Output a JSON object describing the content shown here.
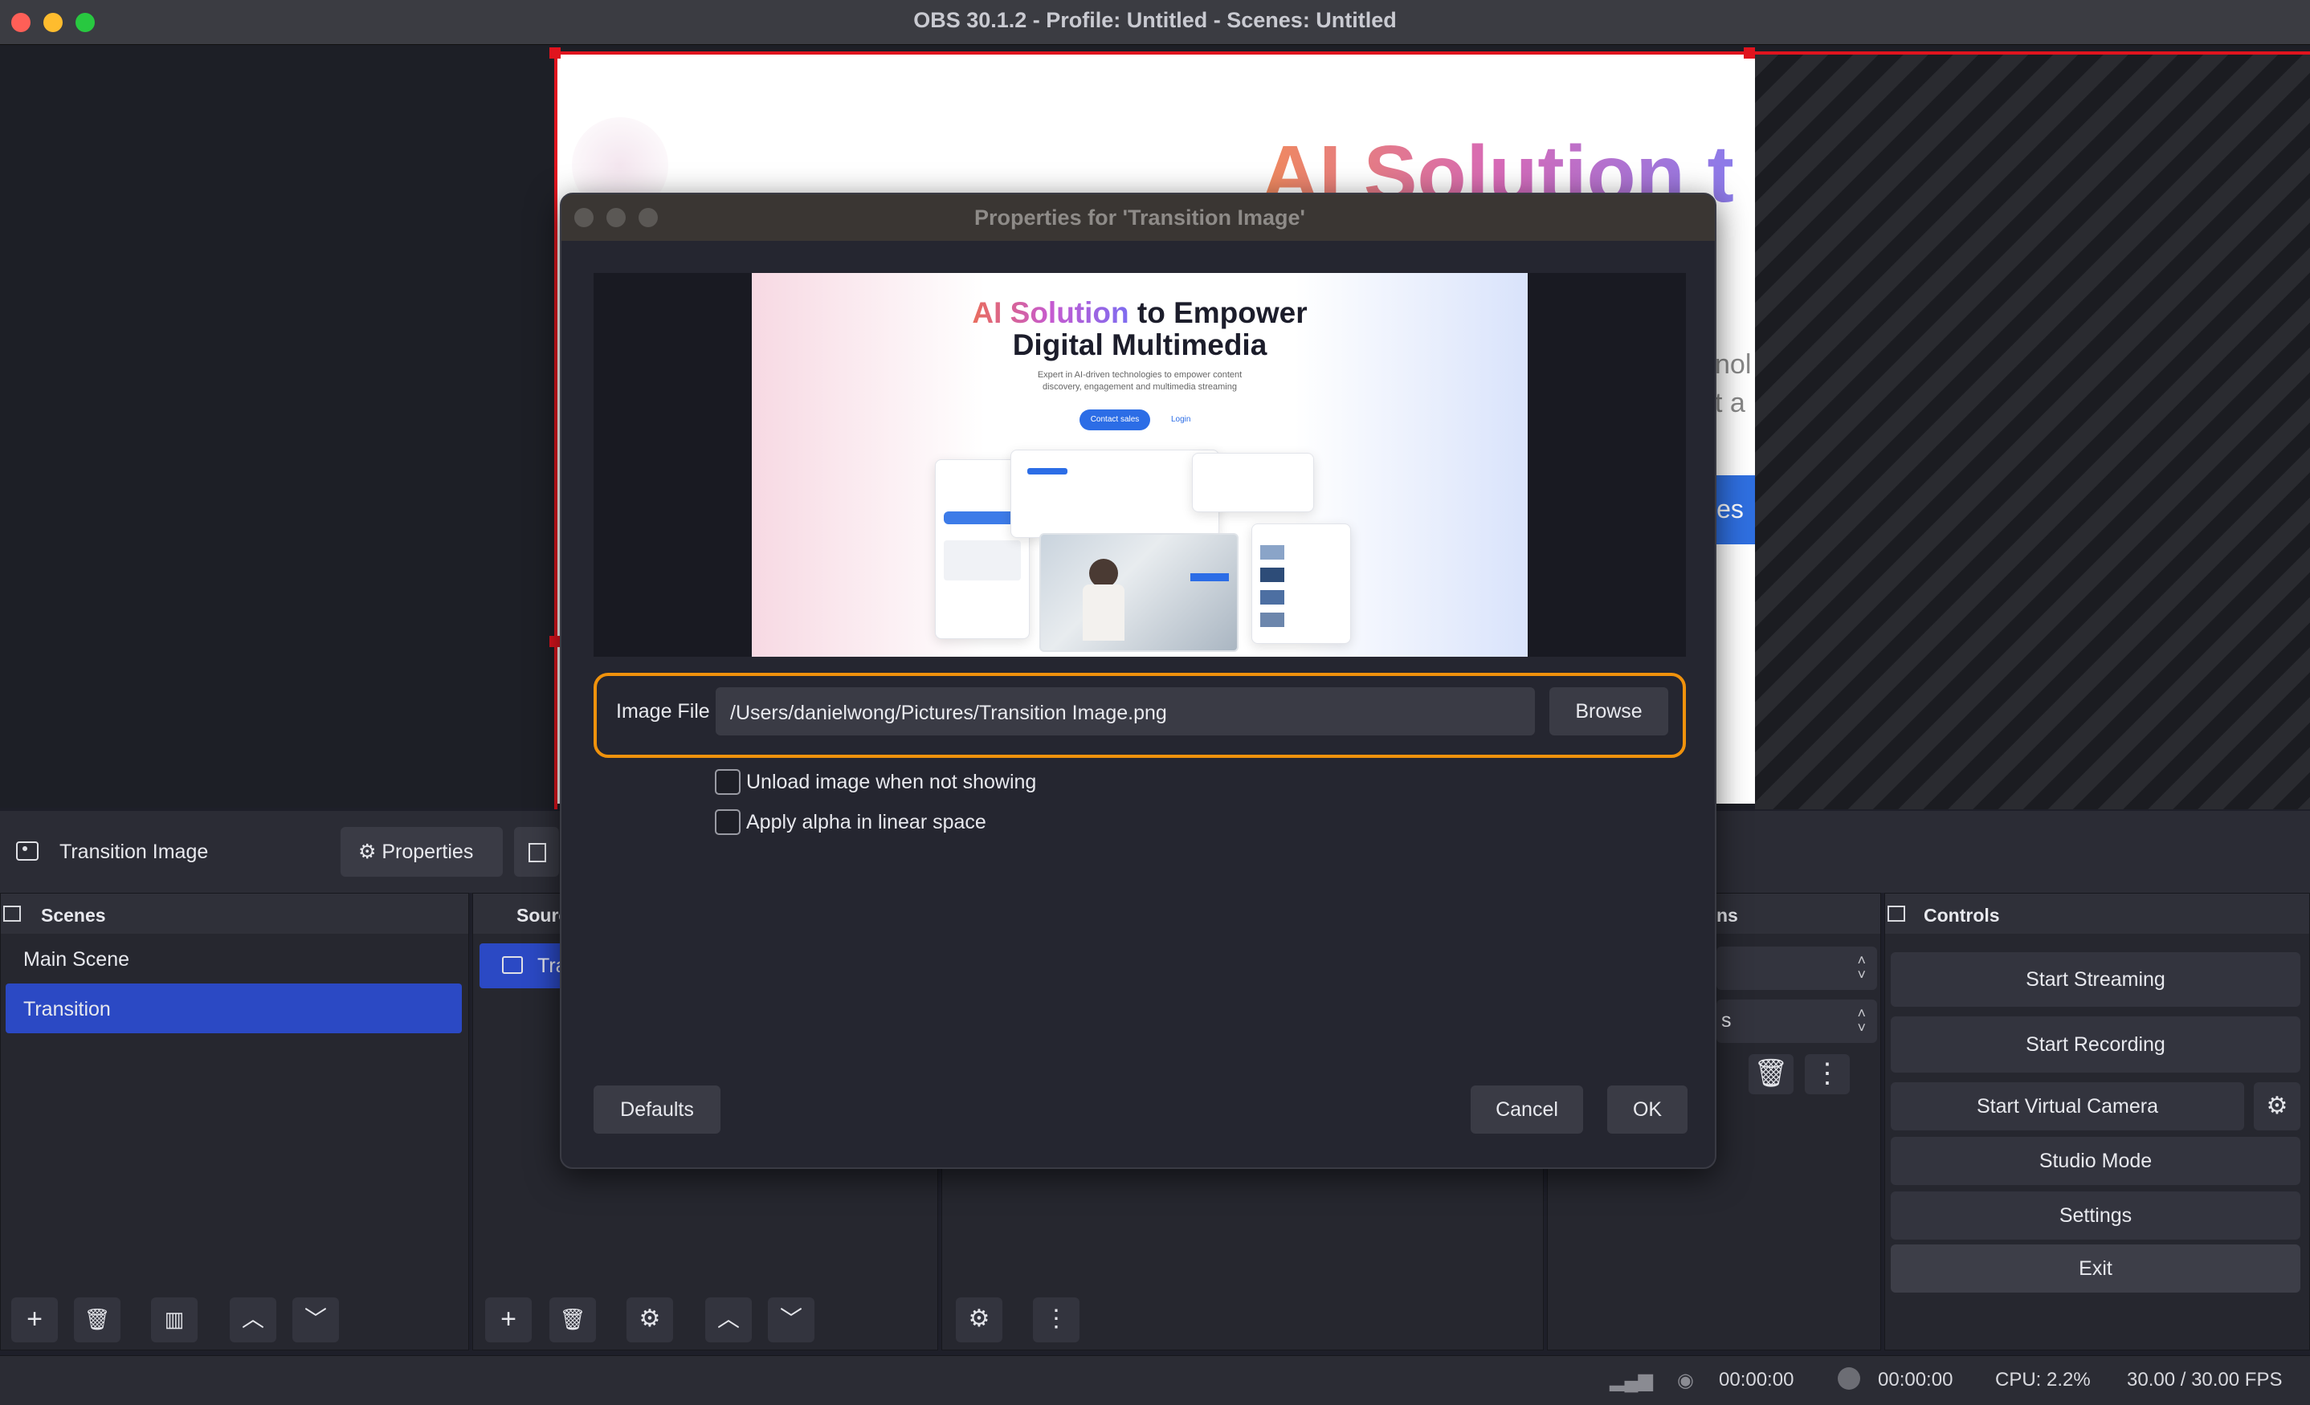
{
  "window": {
    "title": "OBS 30.1.2 - Profile: Untitled - Scenes: Untitled"
  },
  "preview_bg": {
    "headline": "AI Solution t",
    "frag1": "nol",
    "frag2": "t a",
    "button": "les"
  },
  "source_toolbar": {
    "source_name": "Transition Image",
    "properties_label": "Properties"
  },
  "scenes": {
    "title": "Scenes",
    "items": [
      {
        "label": "Main Scene"
      },
      {
        "label": "Transition"
      }
    ]
  },
  "sources": {
    "title": "Sourc",
    "items": [
      {
        "label": "Tra"
      }
    ]
  },
  "transitions": {
    "title": "ns",
    "select_fragment": "s"
  },
  "controls": {
    "title": "Controls",
    "start_streaming": "Start Streaming",
    "start_recording": "Start Recording",
    "start_virtual_camera": "Start Virtual Camera",
    "studio_mode": "Studio Mode",
    "settings": "Settings",
    "exit": "Exit"
  },
  "status_bar": {
    "stream_time": "00:00:00",
    "record_time": "00:00:00",
    "cpu": "CPU: 2.2%",
    "fps": "30.00 / 30.00 FPS"
  },
  "dialog": {
    "title": "Properties for 'Transition Image'",
    "thumbnail": {
      "headline_grad": "AI Solution",
      "headline_rest": " to Empower",
      "headline_line2": "Digital Multimedia",
      "subtitle": "Expert in AI-driven technologies to empower content discovery, engagement and multimedia streaming",
      "contact": "Contact sales",
      "login": "Login"
    },
    "image_file_label": "Image File",
    "image_file_path": "/Users/danielwong/Pictures/Transition Image.png",
    "browse": "Browse",
    "unload_label": "Unload image when not showing",
    "unload_checked": false,
    "alpha_label": "Apply alpha in linear space",
    "alpha_checked": false,
    "defaults": "Defaults",
    "cancel": "Cancel",
    "ok": "OK"
  },
  "colors": {
    "accent": "#2b49c4",
    "focus_ring": "#f0920c",
    "selection": "#e0141e"
  }
}
